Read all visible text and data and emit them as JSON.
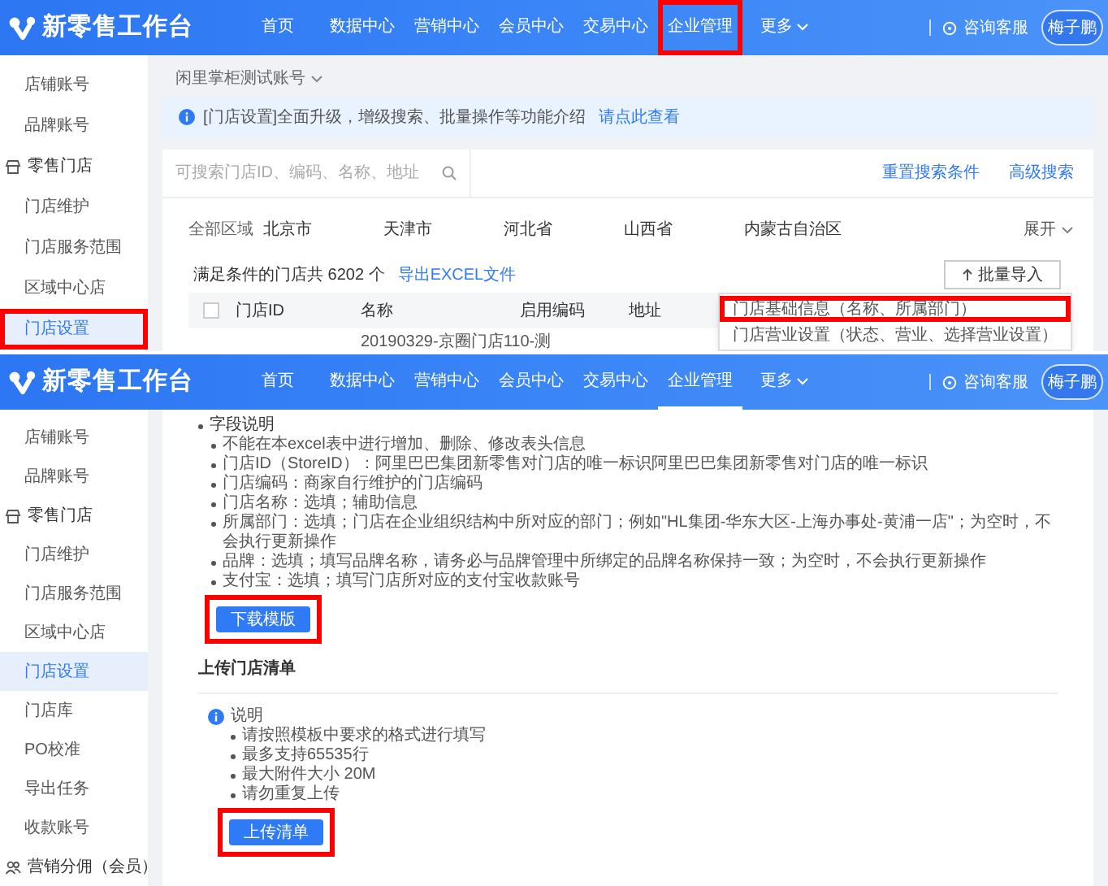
{
  "panels": [
    {
      "kind": "store_list",
      "header": {
        "title": "新零售工作台",
        "nav": [
          {
            "label": "首页",
            "selected": false,
            "highlighted": false,
            "dropdown": false
          },
          {
            "label": "数据中心",
            "selected": false,
            "highlighted": false,
            "dropdown": false
          },
          {
            "label": "营销中心",
            "selected": false,
            "highlighted": false,
            "dropdown": false
          },
          {
            "label": "会员中心",
            "selected": false,
            "highlighted": false,
            "dropdown": false
          },
          {
            "label": "交易中心",
            "selected": false,
            "highlighted": false,
            "dropdown": false
          },
          {
            "label": "企业管理",
            "selected": false,
            "highlighted": true,
            "dropdown": false
          },
          {
            "label": "更多",
            "selected": false,
            "highlighted": false,
            "dropdown": true
          }
        ],
        "support": "咨询客服",
        "avatar": "梅子鹏"
      },
      "sidebar": [
        {
          "label": "店铺账号",
          "kind": "item",
          "selected": false,
          "highlighted": false
        },
        {
          "label": "品牌账号",
          "kind": "item",
          "selected": false,
          "highlighted": false
        },
        {
          "label": "零售门店",
          "kind": "shop",
          "selected": false,
          "highlighted": false
        },
        {
          "label": "门店维护",
          "kind": "item",
          "selected": false,
          "highlighted": false
        },
        {
          "label": "门店服务范围",
          "kind": "item",
          "selected": false,
          "highlighted": false
        },
        {
          "label": "区域中心店",
          "kind": "item",
          "selected": false,
          "highlighted": false
        },
        {
          "label": "门店设置",
          "kind": "item",
          "selected": true,
          "highlighted": true
        }
      ],
      "account": "闲里掌柜测试账号",
      "notice": {
        "text": "[门店设置]全面升级，增级搜索、批量操作等功能介绍",
        "link": "请点此查看"
      },
      "search": {
        "placeholder": "可搜索门店ID、编码、名称、地址"
      },
      "search_links": [
        "重置搜索条件",
        "高级搜索"
      ],
      "regions": [
        "全部区域",
        "北京市",
        "天津市",
        "河北省",
        "山西省",
        "内蒙古自治区"
      ],
      "expand": "展开",
      "summary": "满足条件的门店共 6202 个",
      "export_link": "导出EXCEL文件",
      "import_button": "批量导入",
      "import_menu": [
        {
          "label": "门店基础信息（名称、所属部门）",
          "highlighted": true
        },
        {
          "label": "门店营业设置（状态、营业、选择营业设置）",
          "highlighted": false
        }
      ],
      "table": {
        "select_all": {
          "checked": false
        },
        "columns": [
          "门店ID",
          "名称",
          "启用编码",
          "地址"
        ],
        "rows": [
          {
            "name": "20190329-京圈门店110-测"
          }
        ]
      }
    },
    {
      "kind": "import",
      "header": {
        "title": "新零售工作台",
        "nav": [
          {
            "label": "首页",
            "selected": false,
            "highlighted": false,
            "dropdown": false
          },
          {
            "label": "数据中心",
            "selected": false,
            "highlighted": false,
            "dropdown": false
          },
          {
            "label": "营销中心",
            "selected": false,
            "highlighted": false,
            "dropdown": false
          },
          {
            "label": "会员中心",
            "selected": false,
            "highlighted": false,
            "dropdown": false
          },
          {
            "label": "交易中心",
            "selected": false,
            "highlighted": false,
            "dropdown": false
          },
          {
            "label": "企业管理",
            "selected": true,
            "highlighted": false,
            "dropdown": false
          },
          {
            "label": "更多",
            "selected": false,
            "highlighted": false,
            "dropdown": true
          }
        ],
        "support": "咨询客服",
        "avatar": "梅子鹏"
      },
      "sidebar": [
        {
          "label": "店铺账号",
          "kind": "item",
          "selected": false,
          "highlighted": false
        },
        {
          "label": "品牌账号",
          "kind": "item",
          "selected": false,
          "highlighted": false
        },
        {
          "label": "零售门店",
          "kind": "shop",
          "selected": false,
          "highlighted": false
        },
        {
          "label": "门店维护",
          "kind": "item",
          "selected": false,
          "highlighted": false
        },
        {
          "label": "门店服务范围",
          "kind": "item",
          "selected": false,
          "highlighted": false
        },
        {
          "label": "区域中心店",
          "kind": "item",
          "selected": false,
          "highlighted": false
        },
        {
          "label": "门店设置",
          "kind": "item",
          "selected": true,
          "highlighted": false
        },
        {
          "label": "门店库",
          "kind": "item",
          "selected": false,
          "highlighted": false
        },
        {
          "label": "PO校准",
          "kind": "item",
          "selected": false,
          "highlighted": false
        },
        {
          "label": "导出任务",
          "kind": "item",
          "selected": false,
          "highlighted": false
        },
        {
          "label": "收款账号",
          "kind": "item",
          "selected": false,
          "highlighted": false
        },
        {
          "label": "营销分佣（会员）",
          "kind": "members",
          "selected": false,
          "highlighted": false
        }
      ],
      "fields": {
        "title": "字段说明",
        "items": [
          "不能在本excel表中进行增加、删除、修改表头信息",
          "门店ID（StoreID）：阿里巴巴集团新零售对门店的唯一标识阿里巴巴集团新零售对门店的唯一标识",
          "门店编码：商家自行维护的门店编码",
          "门店名称：选填；辅助信息",
          "所属部门：选填；门店在企业组织结构中所对应的部门；例如\"HL集团-华东大区-上海办事处-黄浦一店\"；为空时，不会执行更新操作",
          "品牌：选填；填写品牌名称，请务必与品牌管理中所绑定的品牌名称保持一致；为空时，不会执行更新操作",
          "支付宝：选填；填写门店所对应的支付宝收款账号"
        ]
      },
      "download_button": {
        "label": "下载模版",
        "highlighted": true
      },
      "upload_section": "上传门店清单",
      "notes": {
        "title": "说明",
        "items": [
          "请按照模板中要求的格式进行填写",
          "最多支持65535行",
          "最大附件大小 20M",
          "请勿重复上传"
        ]
      },
      "upload_button": {
        "label": "上传清单",
        "highlighted": true
      }
    }
  ]
}
